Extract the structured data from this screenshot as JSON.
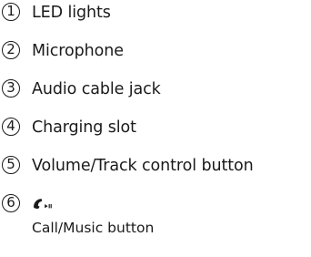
{
  "legend": {
    "items": [
      {
        "number": "1",
        "label": "LED lights"
      },
      {
        "number": "2",
        "label": "Microphone"
      },
      {
        "number": "3",
        "label": "Audio cable jack"
      },
      {
        "number": "4",
        "label": "Charging slot"
      },
      {
        "number": "5",
        "label": "Volume/Track control button"
      },
      {
        "number": "6",
        "icon": "phone-play-pause-icon",
        "description": "Call/Music button"
      }
    ]
  }
}
